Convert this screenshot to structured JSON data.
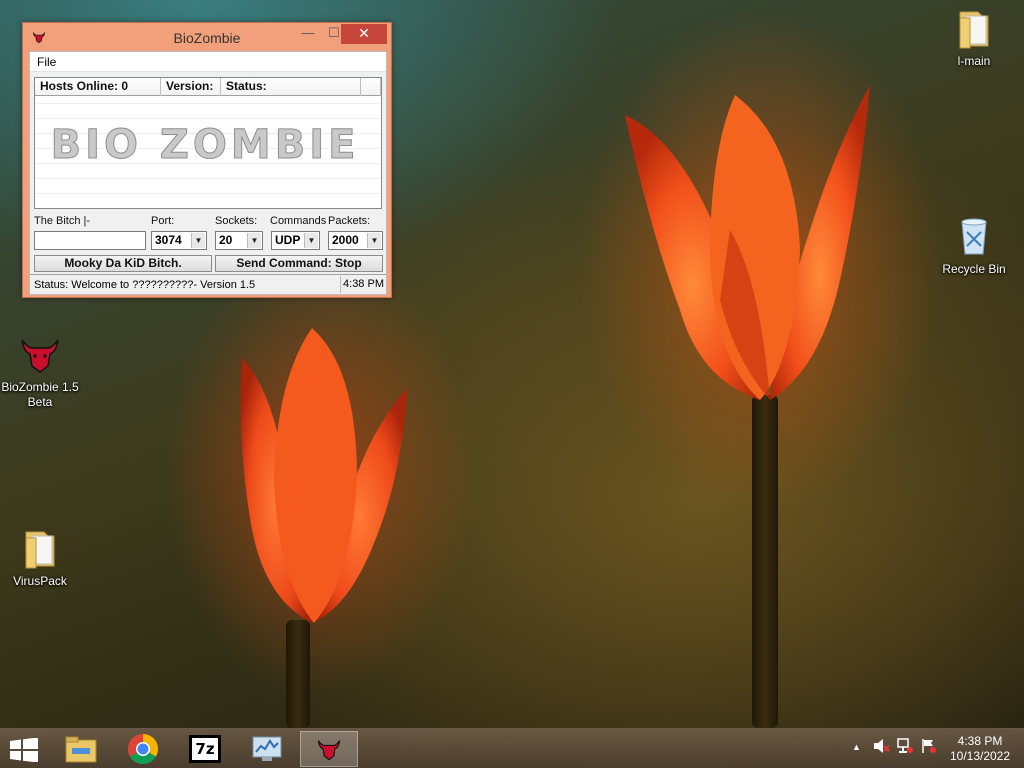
{
  "window": {
    "title": "BioZombie",
    "controls": {
      "minimize": "—",
      "maximize": "☐",
      "close": "✕"
    },
    "menu": {
      "file": "File"
    },
    "list_headers": [
      "Hosts Online: 0",
      "Version:",
      "Status:",
      ""
    ],
    "logo_text": "BIO ZOMBIE",
    "fields": {
      "target_label": "The Bitch |-",
      "target_value": "",
      "port_label": "Port:",
      "port_value": "3074",
      "sockets_label": "Sockets:",
      "sockets_value": "20",
      "commands_label": "Commands",
      "commands_value": "UDP",
      "packets_label": "Packets:",
      "packets_value": "2000"
    },
    "buttons": {
      "left": "Mooky Da KiD Bitch.",
      "send": "Send Command: Stop"
    },
    "status": {
      "text": "Status: Welcome to ??????????- Version 1.5",
      "time": "4:38 PM"
    }
  },
  "desktop": {
    "icons": [
      {
        "label": "l-main"
      },
      {
        "label": "Recycle Bin"
      },
      {
        "label": "BioZombie 1.5 Beta"
      },
      {
        "label": "VirusPack"
      }
    ]
  },
  "taskbar": {
    "apps": [
      "file-explorer-icon",
      "chrome-icon",
      "7zip-icon",
      "resource-monitor-icon",
      "biozombie-icon"
    ],
    "seven_zip_text": "7z",
    "tray": {
      "chevron": "▲"
    },
    "clock": {
      "time": "4:38 PM",
      "date": "10/13/2022"
    }
  },
  "colors": {
    "window_frame": "#f2a07c",
    "close_button": "#c7463c",
    "taskbar": "#6e5a46"
  }
}
